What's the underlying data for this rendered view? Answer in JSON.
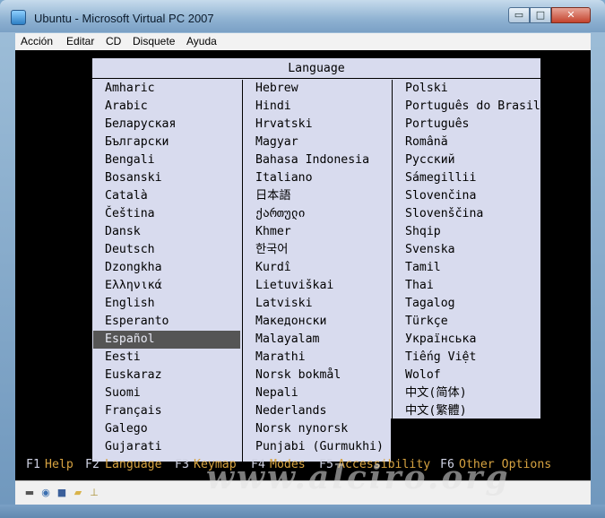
{
  "window": {
    "title": "Ubuntu - Microsoft Virtual PC 2007",
    "minimize_glyph": "▭",
    "maximize_glyph": "□",
    "close_glyph": "✕"
  },
  "menubar": [
    "Acción",
    "Editar",
    "CD",
    "Disquete",
    "Ayuda"
  ],
  "dialog": {
    "title": "Language",
    "selected": "Español",
    "columns": [
      [
        "Amharic",
        "Arabic",
        "Беларуская",
        "Български",
        "Bengali",
        "Bosanski",
        "Català",
        "Čeština",
        "Dansk",
        "Deutsch",
        "Dzongkha",
        "Ελληνικά",
        "English",
        "Esperanto",
        "Español",
        "Eesti",
        "Euskaraz",
        "Suomi",
        "Français",
        "Galego",
        "Gujarati"
      ],
      [
        "Hebrew",
        "Hindi",
        "Hrvatski",
        "Magyar",
        "Bahasa Indonesia",
        "Italiano",
        "日本語",
        "ქართული",
        "Khmer",
        "한국어",
        "Kurdî",
        "Lietuviškai",
        "Latviski",
        "Македонски",
        "Malayalam",
        "Marathi",
        "Norsk bokmål",
        "Nepali",
        "Nederlands",
        "Norsk nynorsk",
        "Punjabi (Gurmukhi)"
      ],
      [
        "Polski",
        "Português do Brasil",
        "Português",
        "Română",
        "Русский",
        "Sámegillii",
        "Slovenčina",
        "Slovenščina",
        "Shqip",
        "Svenska",
        "Tamil",
        "Thai",
        "Tagalog",
        "Türkçe",
        "Українська",
        "Tiếng Việt",
        "Wolof",
        "中文(简体)",
        "中文(繁體)"
      ]
    ]
  },
  "function_keys": [
    {
      "key": "F1",
      "label": "Help"
    },
    {
      "key": "F2",
      "label": "Language"
    },
    {
      "key": "F3",
      "label": "Keymap"
    },
    {
      "key": "F4",
      "label": "Modes"
    },
    {
      "key": "F5",
      "label": "Accessibility"
    },
    {
      "key": "F6",
      "label": "Other Options"
    }
  ],
  "status_icons": [
    "drive-icon",
    "cd-icon",
    "floppy-icon",
    "folder-icon",
    "network-icon"
  ],
  "watermark": "www.alciro.org",
  "colors": {
    "dialog_bg": "#d8dbee",
    "selected_bg": "#555555",
    "fkey_action": "#d7a341",
    "screen_bg": "#000000"
  }
}
